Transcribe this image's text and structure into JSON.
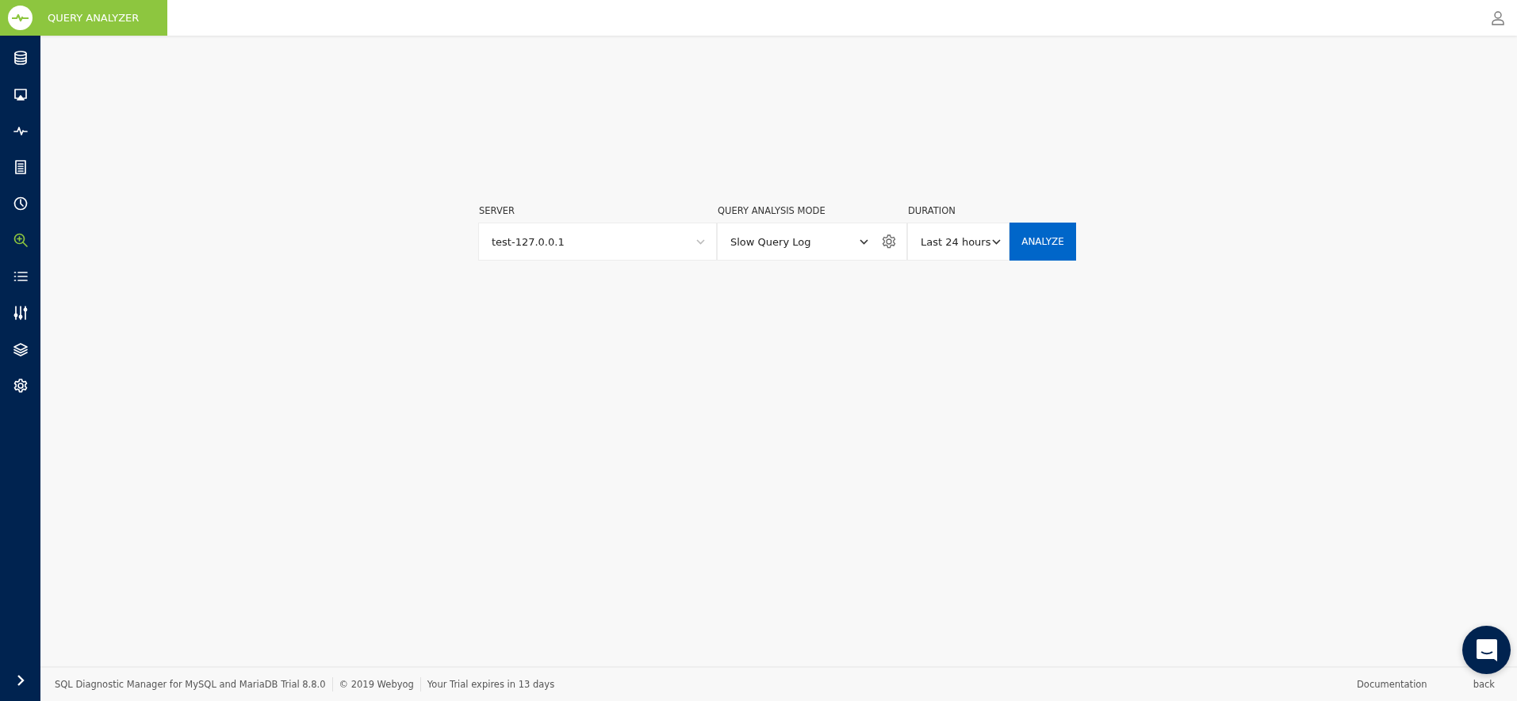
{
  "header": {
    "title": "QUERY ANALYZER"
  },
  "sidebar": {
    "items": [
      {
        "kind": "database",
        "selected": false
      },
      {
        "kind": "monitor",
        "selected": false
      },
      {
        "kind": "pulse",
        "selected": false
      },
      {
        "kind": "document",
        "selected": false
      },
      {
        "kind": "clock",
        "selected": false
      },
      {
        "kind": "zoom",
        "selected": true
      },
      {
        "kind": "list",
        "selected": false
      },
      {
        "kind": "sliders",
        "selected": false
      },
      {
        "kind": "layers",
        "selected": false
      },
      {
        "kind": "gear",
        "selected": false
      }
    ]
  },
  "form": {
    "server": {
      "label": "SERVER",
      "value": "test-127.0.0.1"
    },
    "mode": {
      "label": "QUERY ANALYSIS MODE",
      "value": "Slow Query Log"
    },
    "duration": {
      "label": "DURATION",
      "value": "Last 24 hours"
    },
    "button": "ANALYZE"
  },
  "footer": {
    "product": "SQL Diagnostic Manager for MySQL and MariaDB",
    "version": "Trial 8.8.0",
    "copyright": "©  2019 Webyog",
    "trial": "Your Trial expires in 13 days",
    "links": [
      "Documentation",
      "back"
    ]
  }
}
